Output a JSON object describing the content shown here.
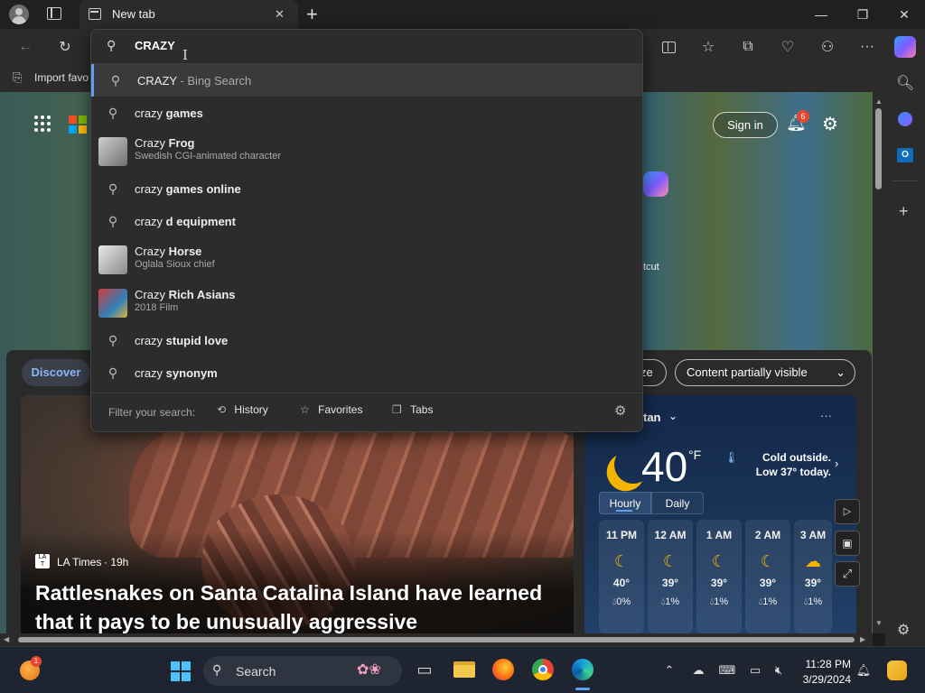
{
  "window": {
    "tab_title": "New tab",
    "new_tab_symbol": "+",
    "minimize": "—",
    "maximize": "❐",
    "close": "✕"
  },
  "address_bar": {
    "value": "CRAZY",
    "caret": "I"
  },
  "favorites_bar": {
    "import_label": "Import favo"
  },
  "suggestions": {
    "top": {
      "query": "CRAZY",
      "suffix": " - Bing Search"
    },
    "items": [
      {
        "prefix": "crazy ",
        "bold": "games",
        "sub": ""
      },
      {
        "prefix": "Crazy ",
        "bold": "Frog",
        "sub": "Swedish CGI-animated character"
      },
      {
        "prefix": "crazy ",
        "bold": "games online",
        "sub": ""
      },
      {
        "prefix": "crazy ",
        "bold": "d equipment",
        "sub": ""
      },
      {
        "prefix": "Crazy ",
        "bold": "Horse",
        "sub": "Oglala Sioux chief"
      },
      {
        "prefix": "Crazy ",
        "bold": "Rich Asians",
        "sub": "2018 Film"
      },
      {
        "prefix": "crazy ",
        "bold": "stupid love",
        "sub": ""
      },
      {
        "prefix": "crazy ",
        "bold": "synonym",
        "sub": ""
      }
    ],
    "filter_label": "Filter your search:",
    "filter_history": "History",
    "filter_favorites": "Favorites",
    "filter_tabs": "Tabs"
  },
  "page": {
    "sign_in": "Sign in",
    "notif_count": "6",
    "shortcut_partial": "tcut",
    "discover_tab": "Discover",
    "personalize_partial": "ze",
    "content_visibility": "Content partially visible",
    "article": {
      "source": "LA Times",
      "age": "· 19h",
      "headline": "Rattlesnakes on Santa Catalina Island have learned that it pays to be unusually aggressive"
    },
    "weather": {
      "location_partial": "tan",
      "more": "···",
      "temp": "40",
      "unit": "°F",
      "desc": "Cold outside. Low 37° today.",
      "tab_hourly": "Hourly",
      "tab_daily": "Daily",
      "hours": [
        {
          "time": "11 PM",
          "temp": "40°",
          "precip": "0%"
        },
        {
          "time": "12 AM",
          "temp": "39°",
          "precip": "1%"
        },
        {
          "time": "1 AM",
          "temp": "39°",
          "precip": "1%"
        },
        {
          "time": "2 AM",
          "temp": "39°",
          "precip": "1%"
        },
        {
          "time": "3 AM",
          "temp": "39°",
          "precip": "1%"
        }
      ]
    }
  },
  "taskbar": {
    "search_label": "Search",
    "widget_badge": "1",
    "time": "11:28 PM",
    "date": "3/29/2024"
  },
  "colors": {
    "accent": "#5ea0ef",
    "badge": "#e8452e",
    "taskbar": "#1f2530"
  }
}
